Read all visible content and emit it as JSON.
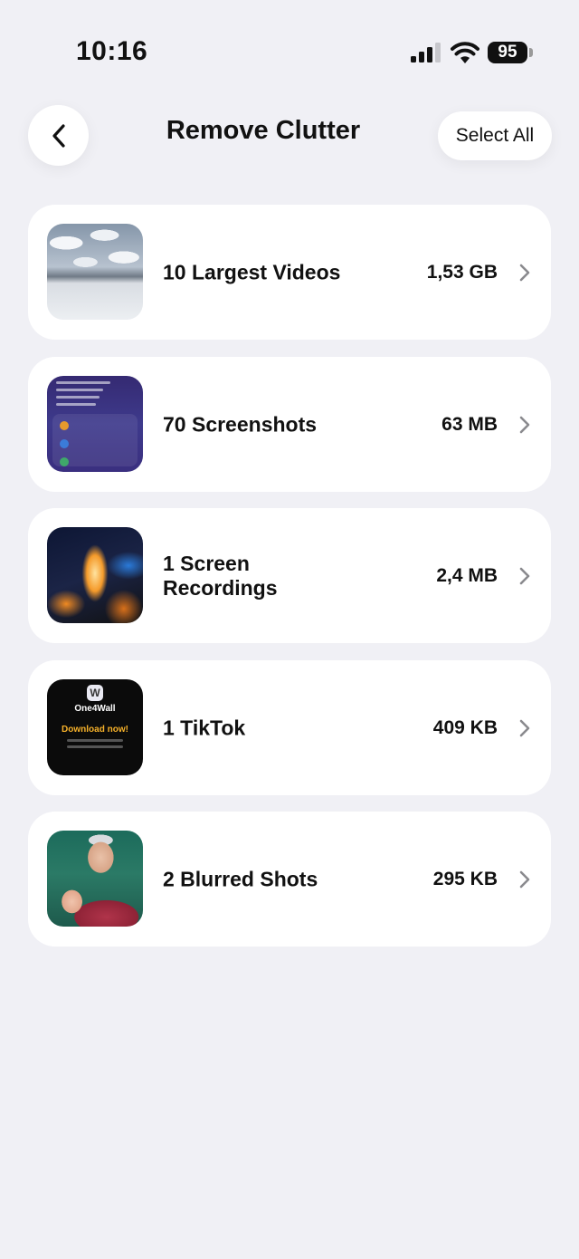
{
  "status_bar": {
    "time": "10:16",
    "battery": "95",
    "icons": [
      "cellular-signal-icon",
      "wifi-icon",
      "battery-icon"
    ]
  },
  "header": {
    "back_icon": "chevron-left-icon",
    "title": "Remove Clutter",
    "select_all_label": "Select All"
  },
  "categories": [
    {
      "label": "10 Largest Videos",
      "size": "1,53 GB",
      "thumbnail": "snowy-landscape"
    },
    {
      "label": "70 Screenshots",
      "size": "63 MB",
      "thumbnail": "app-screenshot"
    },
    {
      "label": "1 Screen Recordings",
      "size": "2,4 MB",
      "thumbnail": "fire-artwork"
    },
    {
      "label": "1 TikTok",
      "size": "409 KB",
      "thumbnail": "one4wall-ad",
      "thumbnail_text": {
        "brand": "One4Wall",
        "cta": "Download now!"
      }
    },
    {
      "label": "2 Blurred Shots",
      "size": "295 KB",
      "thumbnail": "portrait-photo"
    }
  ],
  "colors": {
    "background": "#f0f0f5",
    "card": "#ffffff",
    "text": "#111111",
    "chevron": "#8a8a8e"
  }
}
